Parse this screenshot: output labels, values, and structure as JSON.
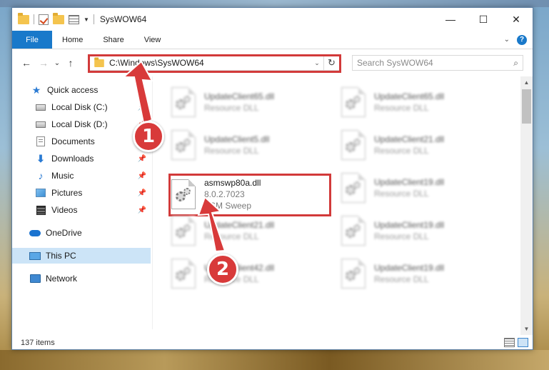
{
  "window": {
    "title": "SysWOW64",
    "controls": {
      "minimize": "—",
      "maximize": "☐",
      "close": "✕"
    }
  },
  "ribbon": {
    "tabs": [
      "File",
      "Home",
      "Share",
      "View"
    ]
  },
  "navigation": {
    "back": "←",
    "forward": "→",
    "recent": "⌄",
    "up": "↑",
    "address_path": "C:\\Windows\\SysWOW64",
    "search_placeholder": "Search SysWOW64"
  },
  "sidebar": {
    "items": [
      {
        "label": "Quick access",
        "icon": "star-icon",
        "pinned": false
      },
      {
        "label": "Local Disk (C:)",
        "icon": "drive-icon",
        "pinned": true
      },
      {
        "label": "Local Disk (D:)",
        "icon": "drive-icon",
        "pinned": true
      },
      {
        "label": "Documents",
        "icon": "documents-icon",
        "pinned": true
      },
      {
        "label": "Downloads",
        "icon": "download-icon",
        "pinned": true
      },
      {
        "label": "Music",
        "icon": "music-icon",
        "pinned": true
      },
      {
        "label": "Pictures",
        "icon": "pictures-icon",
        "pinned": true
      },
      {
        "label": "Videos",
        "icon": "videos-icon",
        "pinned": true
      },
      {
        "label": "OneDrive",
        "icon": "cloud-icon",
        "pinned": false
      },
      {
        "label": "This PC",
        "icon": "pc-icon",
        "pinned": false,
        "selected": true
      },
      {
        "label": "Network",
        "icon": "network-icon",
        "pinned": false
      }
    ]
  },
  "files": [
    {
      "name": "UpdateClient65.dll",
      "sub": "Resource DLL",
      "blurred": true
    },
    {
      "name": "UpdateClient65.dll",
      "sub": "Resource DLL",
      "blurred": true
    },
    {
      "name": "UpdateClient5.dll",
      "sub": "Resource DLL",
      "blurred": true
    },
    {
      "name": "UpdateClient21.dll",
      "sub": "Resource DLL",
      "blurred": true
    },
    {
      "name": "asmswp80a.dll",
      "version": "8.0.2.7023",
      "sub": "ASM Sweep",
      "blurred": false
    },
    {
      "name": "UpdateClient19.dll",
      "sub": "Resource DLL",
      "blurred": true
    },
    {
      "name": "UpdateClient21.dll",
      "sub": "Resource DLL",
      "blurred": true
    },
    {
      "name": "UpdateClient19.dll",
      "sub": "Resource DLL",
      "blurred": true
    },
    {
      "name": "UpdateClient42.dll",
      "sub": "Resource DLL",
      "blurred": true
    },
    {
      "name": "UpdateClient19.dll",
      "sub": "Resource DLL",
      "blurred": true
    }
  ],
  "status": {
    "item_count": "137 items"
  },
  "annotations": {
    "step1": "1",
    "step2": "2",
    "highlight_color": "#d23a3a"
  },
  "colors": {
    "accent": "#1979ca",
    "selection": "#cce4f7"
  }
}
